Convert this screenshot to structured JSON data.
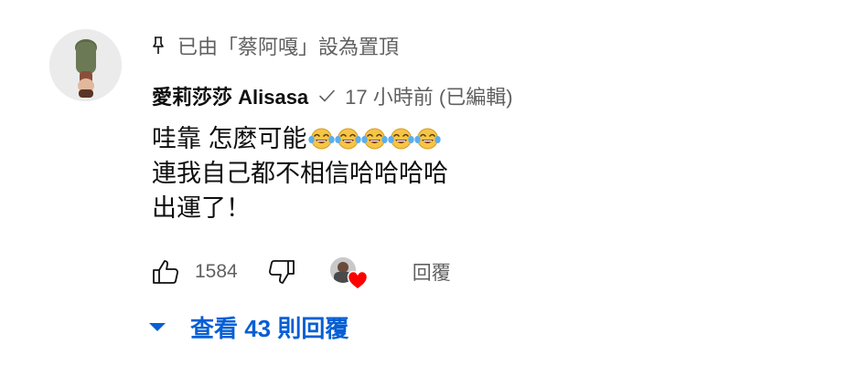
{
  "comment": {
    "pinned_text": "已由「蔡阿嘎」設為置頂",
    "author": "愛莉莎莎 Alisasa",
    "timestamp": "17 小時前 (已編輯)",
    "lines": [
      "哇靠 怎麼可能",
      "連我自己都不相信哈哈哈哈",
      "出運了！"
    ],
    "emoji_name": "face-with-tears-of-joy",
    "emoji_count": 5
  },
  "actions": {
    "like_count": "1584",
    "reply_label": "回覆"
  },
  "replies": {
    "view_label": "查看 43 則回覆"
  },
  "icons": {
    "pin": "pin-icon",
    "verified": "checkmark-icon",
    "like": "thumbs-up-icon",
    "dislike": "thumbs-down-icon",
    "heart": "heart-icon",
    "caret": "caret-down-icon"
  },
  "colors": {
    "secondary_text": "#606060",
    "link_blue": "#065fd4",
    "heart_red": "#ff0000"
  }
}
